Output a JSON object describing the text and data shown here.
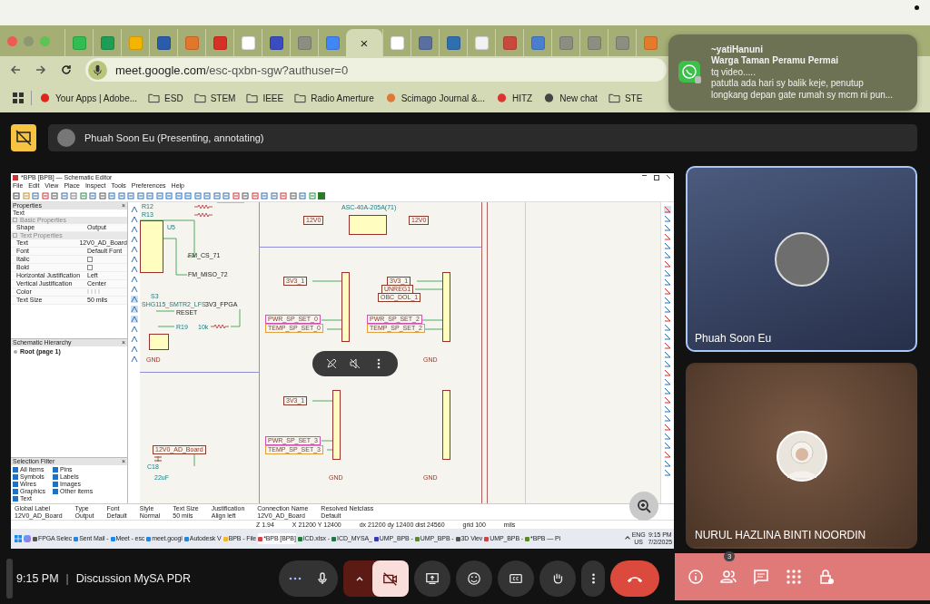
{
  "browser": {
    "tabs": [
      {
        "selected": false
      },
      {
        "selected": false
      },
      {
        "selected": false
      },
      {
        "selected": false
      },
      {
        "selected": false
      },
      {
        "selected": false
      },
      {
        "selected": false
      },
      {
        "selected": false
      },
      {
        "selected": false
      },
      {
        "selected": false
      },
      {
        "selected": true,
        "close": "×"
      },
      {
        "selected": false
      },
      {
        "selected": false
      },
      {
        "selected": false
      },
      {
        "selected": false
      },
      {
        "selected": false
      },
      {
        "selected": false
      },
      {
        "selected": false
      },
      {
        "selected": false
      },
      {
        "selected": false
      },
      {
        "selected": false
      }
    ],
    "address": {
      "host": "meet.google.com",
      "path": "/esc-qxbn-sgw?authuser=0"
    },
    "bookmarks": [
      {
        "kind": "site",
        "label": "Your Apps | Adobe..."
      },
      {
        "kind": "folder",
        "label": "ESD"
      },
      {
        "kind": "folder",
        "label": "STEM"
      },
      {
        "kind": "folder",
        "label": "IEEE"
      },
      {
        "kind": "folder",
        "label": "Radio Amerture"
      },
      {
        "kind": "site",
        "label": "Scimago Journal &..."
      },
      {
        "kind": "site",
        "label": "HITZ"
      },
      {
        "kind": "site",
        "label": "New chat"
      },
      {
        "kind": "folder",
        "label": "STE"
      }
    ]
  },
  "notification": {
    "sender": "~yatiHanuni",
    "group": "Warga Taman Peramu Permai",
    "lines": [
      "tq video.....",
      "patutla ada hari sy balik keje, penutup",
      "longkang depan gate rumah sy mcm ni pun..."
    ]
  },
  "presenter_bar": {
    "text": "Phuah Soon Eu (Presenting, annotating)"
  },
  "shared_screen": {
    "title": "*BPB [BPB] — Schematic Editor",
    "menu": [
      "File",
      "Edit",
      "View",
      "Place",
      "Inspect",
      "Tools",
      "Preferences",
      "Help"
    ],
    "properties": {
      "title": "Properties",
      "close": "×",
      "item": "Text",
      "sections": [
        {
          "name": "Basic Properties",
          "rows": [
            {
              "label": "Shape",
              "kind": "text",
              "value": "Output"
            }
          ]
        },
        {
          "name": "Text Properties",
          "rows": [
            {
              "label": "Text",
              "kind": "text",
              "value": "12V0_AD_Board"
            },
            {
              "label": "Font",
              "kind": "text",
              "value": "Default Font"
            },
            {
              "label": "Italic",
              "kind": "checkbox",
              "checked": false
            },
            {
              "label": "Bold",
              "kind": "checkbox",
              "checked": false
            },
            {
              "label": "Horizontal Justification",
              "kind": "text",
              "value": "Left"
            },
            {
              "label": "Vertical Justification",
              "kind": "text",
              "value": "Center"
            },
            {
              "label": "Color",
              "kind": "swatch"
            },
            {
              "label": "Text Size",
              "kind": "text",
              "value": "50 mils"
            }
          ]
        }
      ]
    },
    "hierarchy": {
      "title": "Schematic Hierarchy",
      "close": "×",
      "root": "Root (page 1)"
    },
    "selection_filter": {
      "title": "Selection Filter",
      "close": "×",
      "items": [
        {
          "label": "All items",
          "checked": true
        },
        {
          "label": "Symbols",
          "checked": true
        },
        {
          "label": "Wires",
          "checked": true
        },
        {
          "label": "Graphics",
          "checked": true
        },
        {
          "label": "Text",
          "checked": true
        },
        {
          "label": "Pins",
          "checked": true
        },
        {
          "label": "Labels",
          "checked": true
        },
        {
          "label": "Images",
          "checked": true
        },
        {
          "label": "Other items",
          "checked": true
        }
      ]
    },
    "schematic_labels": [
      {
        "kind": "ref",
        "text": "R12"
      },
      {
        "kind": "ref",
        "text": "ASC-40A-205A(71)"
      },
      {
        "kind": "ref",
        "text": "R13"
      },
      {
        "kind": "global",
        "text": "12V0",
        "color": "#8b3a2a"
      },
      {
        "kind": "global",
        "text": "12V0",
        "color": "#8b3a2a"
      },
      {
        "kind": "ref",
        "text": "U5"
      },
      {
        "kind": "net",
        "text": "FM_CS_71"
      },
      {
        "kind": "net",
        "text": "FM_MISO_72"
      },
      {
        "kind": "global",
        "text": "3V3_1",
        "color": "#8b3a2a"
      },
      {
        "kind": "global",
        "text": "3V3_1",
        "color": "#8b3a2a"
      },
      {
        "kind": "global",
        "text": "UNREG1",
        "color": "#8b3a2a"
      },
      {
        "kind": "ref",
        "text": "S3"
      },
      {
        "kind": "global",
        "text": "OBC_DOL_1",
        "color": "#8b3a2a"
      },
      {
        "kind": "ref",
        "text": "SHG115_SMTR2_LFS"
      },
      {
        "kind": "net",
        "text": "3V3_FPGA"
      },
      {
        "kind": "net",
        "text": "RESET"
      },
      {
        "kind": "global",
        "text": "PWR_SP_SET_0",
        "color": "#d050b0"
      },
      {
        "kind": "global",
        "text": "PWR_SP_SET_2",
        "color": "#d050b0"
      },
      {
        "kind": "ref",
        "text": "R19"
      },
      {
        "kind": "ref",
        "text": "10k"
      },
      {
        "kind": "global",
        "text": "TEMP_SP_SET_0",
        "color": "#e0a040"
      },
      {
        "kind": "global",
        "text": "TEMP_SP_SET_2",
        "color": "#e0a040"
      },
      {
        "kind": "power",
        "text": "GND"
      },
      {
        "kind": "power",
        "text": "GND"
      },
      {
        "kind": "global",
        "text": "3V3_1",
        "color": "#8b3a2a"
      },
      {
        "kind": "global",
        "text": "PWR_SP_SET_3",
        "color": "#d050b0"
      },
      {
        "kind": "global",
        "text": "12V0_AD_Board",
        "color": "#8b3a2a"
      },
      {
        "kind": "global",
        "text": "TEMP_SP_SET_3",
        "color": "#e0a040"
      },
      {
        "kind": "ref",
        "text": "C18"
      },
      {
        "kind": "ref",
        "text": "22uF"
      },
      {
        "kind": "power",
        "text": "GND"
      },
      {
        "kind": "power",
        "text": "GND"
      }
    ],
    "info": [
      {
        "label": "Global Label",
        "value": "12V0_AD_Board"
      },
      {
        "label": "Type",
        "value": "Output"
      },
      {
        "label": "Font",
        "value": "Default"
      },
      {
        "label": "Style",
        "value": "Normal"
      },
      {
        "label": "Text Size",
        "value": "50 mils"
      },
      {
        "label": "Justification",
        "value": "Align left"
      },
      {
        "label": "Connection Name",
        "value": "12V0_AD_Board"
      },
      {
        "label": "Resolved Netclass",
        "value": "Default"
      }
    ],
    "status": [
      "Z 1.94",
      "X 21200  Y 12400",
      "dx 21200  dy 12400  dist 24560",
      "grid 100",
      "mils"
    ],
    "taskbar": {
      "apps": [
        {
          "label": "FPGA Selec",
          "selected": false
        },
        {
          "label": "Sent Mail -",
          "selected": false
        },
        {
          "label": "Meet - esc",
          "selected": false
        },
        {
          "label": "meet.googl",
          "selected": false
        },
        {
          "label": "Autodesk V",
          "selected": false
        },
        {
          "label": "BPB - File",
          "selected": false
        },
        {
          "label": "*BPB [BPB]",
          "selected": true
        },
        {
          "label": "ICD.xlsx -",
          "selected": false
        },
        {
          "label": "ICD_MYSA_",
          "selected": false
        },
        {
          "label": "UMP_BPB -",
          "selected": false
        },
        {
          "label": "UMP_BPB -",
          "selected": false
        },
        {
          "label": "3D Viev",
          "selected": false
        },
        {
          "label": "UMP_BPB -",
          "selected": false
        },
        {
          "label": "*BPB — Pi",
          "selected": false
        }
      ],
      "language": "ENG",
      "region": "US",
      "time": "9:15 PM",
      "date": "7/2/2025"
    }
  },
  "participants": [
    {
      "name": "Phuah Soon Eu",
      "selected": true,
      "kind": "photo"
    },
    {
      "name": "NURUL HAZLINA BINTI NOORDIN",
      "selected": false,
      "kind": "avatar"
    }
  ],
  "call_bar": {
    "time": "9:15 PM",
    "separator": "|",
    "meeting": "Discussion MySA PDR",
    "camera_off": true,
    "people_count": "3"
  }
}
